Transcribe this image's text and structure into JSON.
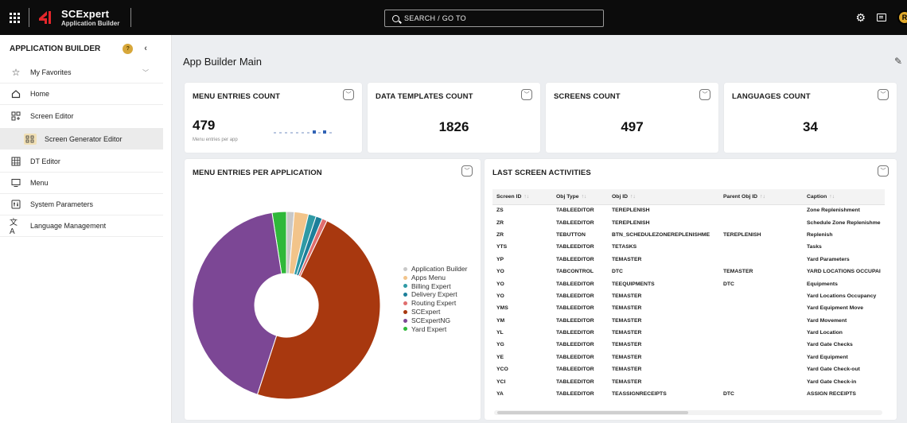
{
  "app": {
    "name": "SCExpert",
    "subtitle": "Application Builder",
    "search_label": "SEARCH / GO TO",
    "avatar_initial": "R"
  },
  "sidebar": {
    "header": "APPLICATION BUILDER",
    "items": [
      {
        "label": "My Favorites",
        "icon": "star-icon"
      },
      {
        "label": "Home",
        "icon": "home-icon"
      },
      {
        "label": "Screen Editor",
        "icon": "screen-editor-icon"
      },
      {
        "label": "Screen Generator Editor",
        "icon": "generator-icon"
      },
      {
        "label": "DT Editor",
        "icon": "dt-editor-icon"
      },
      {
        "label": "Menu",
        "icon": "menu-icon"
      },
      {
        "label": "System Parameters",
        "icon": "parameters-icon"
      },
      {
        "label": "Language Management",
        "icon": "language-icon"
      }
    ]
  },
  "main": {
    "title": "App Builder Main"
  },
  "cards": {
    "menu_entries": {
      "title": "MENU ENTRIES COUNT",
      "value": "479",
      "note": "Menu entries per app"
    },
    "data_templates": {
      "title": "DATA TEMPLATES COUNT",
      "value": "1826"
    },
    "screens": {
      "title": "SCREENS COUNT",
      "value": "497"
    },
    "languages": {
      "title": "LANGUAGES COUNT",
      "value": "34"
    },
    "pie": {
      "title": "MENU ENTRIES PER APPLICATION"
    },
    "activities": {
      "title": "LAST SCREEN ACTIVITIES"
    }
  },
  "chart_data": {
    "type": "pie",
    "title": "MENU ENTRIES PER APPLICATION",
    "legend_position": "right",
    "categories": [
      "Application Builder",
      "Apps Menu",
      "Billing Expert",
      "Delivery Expert",
      "Routing Expert",
      "SCExpert",
      "SCExpertNG",
      "Yard Expert"
    ],
    "values": [
      6,
      11,
      6,
      5,
      4,
      215,
      191,
      11
    ],
    "colors": [
      "#c8c8c8",
      "#f2c48a",
      "#2f9aa5",
      "#1c7f9a",
      "#e06e6e",
      "#a8380f",
      "#7c4795",
      "#2fb83a"
    ],
    "donut": true
  },
  "activities_table": {
    "columns": [
      "Screen ID",
      "Obj Type",
      "Obj ID",
      "Parent Obj ID",
      "Caption"
    ],
    "rows": [
      [
        "ZS",
        "TABLEEDITOR",
        "TEREPLENISH",
        "",
        "Zone Replenishment"
      ],
      [
        "ZR",
        "TABLEEDITOR",
        "TEREPLENISH",
        "",
        "Schedule Zone Replenishme"
      ],
      [
        "ZR",
        "TEBUTTON",
        "BTN_SCHEDULEZONEREPLENISHME",
        "TEREPLENISH",
        "Replenish"
      ],
      [
        "YTS",
        "TABLEEDITOR",
        "TETASKS",
        "",
        "Tasks"
      ],
      [
        "YP",
        "TABLEEDITOR",
        "TEMASTER",
        "",
        "Yard Parameters"
      ],
      [
        "YO",
        "TABCONTROL",
        "DTC",
        "TEMASTER",
        "YARD LOCATIONS OCCUPAI"
      ],
      [
        "YO",
        "TABLEEDITOR",
        "TEEQUIPMENTS",
        "DTC",
        "Equipments"
      ],
      [
        "YO",
        "TABLEEDITOR",
        "TEMASTER",
        "",
        "Yard Locations Occupancy"
      ],
      [
        "YMS",
        "TABLEEDITOR",
        "TEMASTER",
        "",
        "Yard Equipment Move"
      ],
      [
        "YM",
        "TABLEEDITOR",
        "TEMASTER",
        "",
        "Yard Movement"
      ],
      [
        "YL",
        "TABLEEDITOR",
        "TEMASTER",
        "",
        "Yard Location"
      ],
      [
        "YG",
        "TABLEEDITOR",
        "TEMASTER",
        "",
        "Yard Gate Checks"
      ],
      [
        "YE",
        "TABLEEDITOR",
        "TEMASTER",
        "",
        "Yard Equipment"
      ],
      [
        "YCO",
        "TABLEEDITOR",
        "TEMASTER",
        "",
        "Yard Gate Check-out"
      ],
      [
        "YCI",
        "TABLEEDITOR",
        "TEMASTER",
        "",
        "Yard Gate Check-in"
      ],
      [
        "YA",
        "TABLEEDITOR",
        "TEASSIGNRECEIPTS",
        "DTC",
        "ASSIGN RECEIPTS"
      ]
    ]
  }
}
